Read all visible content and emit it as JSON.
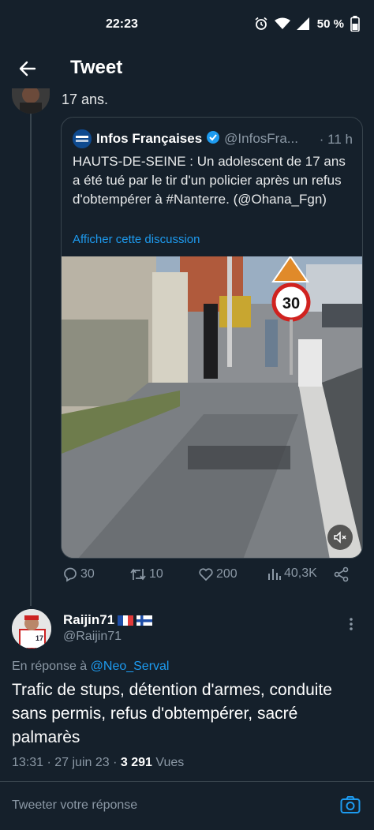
{
  "status_bar": {
    "time": "22:23",
    "battery": "50 %"
  },
  "header": {
    "title": "Tweet"
  },
  "previous_tweet": {
    "text_tail": "17 ans."
  },
  "quoted_tweet": {
    "name": "Infos Françaises",
    "handle": "@InfosFra...",
    "time": "· 11 h",
    "avatar_text": "Infos Françaises",
    "text": "HAUTS-DE-SEINE : Un adolescent de 17 ans a été tué par le tir d'un policier après un refus d'obtempérer à #Nanterre. (@Ohana_Fgn)",
    "show_thread": "Afficher cette discussion",
    "speed_sign": "30"
  },
  "actions": {
    "replies": "30",
    "retweets": "10",
    "likes": "200",
    "views": "40,3K"
  },
  "reply": {
    "name": "Raijin71",
    "handle": "@Raijin71",
    "in_reply_prefix": "En réponse à",
    "in_reply_handle": "@Neo_Serval",
    "text": "Trafic de stups, détention d'armes, conduite sans permis, refus d'obtempérer, sacré palmarès",
    "datetime": "13:31 · 27 juin 23 ·",
    "views_count": "3 291",
    "views_label": "Vues"
  },
  "compose": {
    "placeholder": "Tweeter votre réponse"
  },
  "colors": {
    "background": "#15202b",
    "accent": "#1d9bf0",
    "muted": "#8b98a5",
    "border": "#38444d"
  }
}
